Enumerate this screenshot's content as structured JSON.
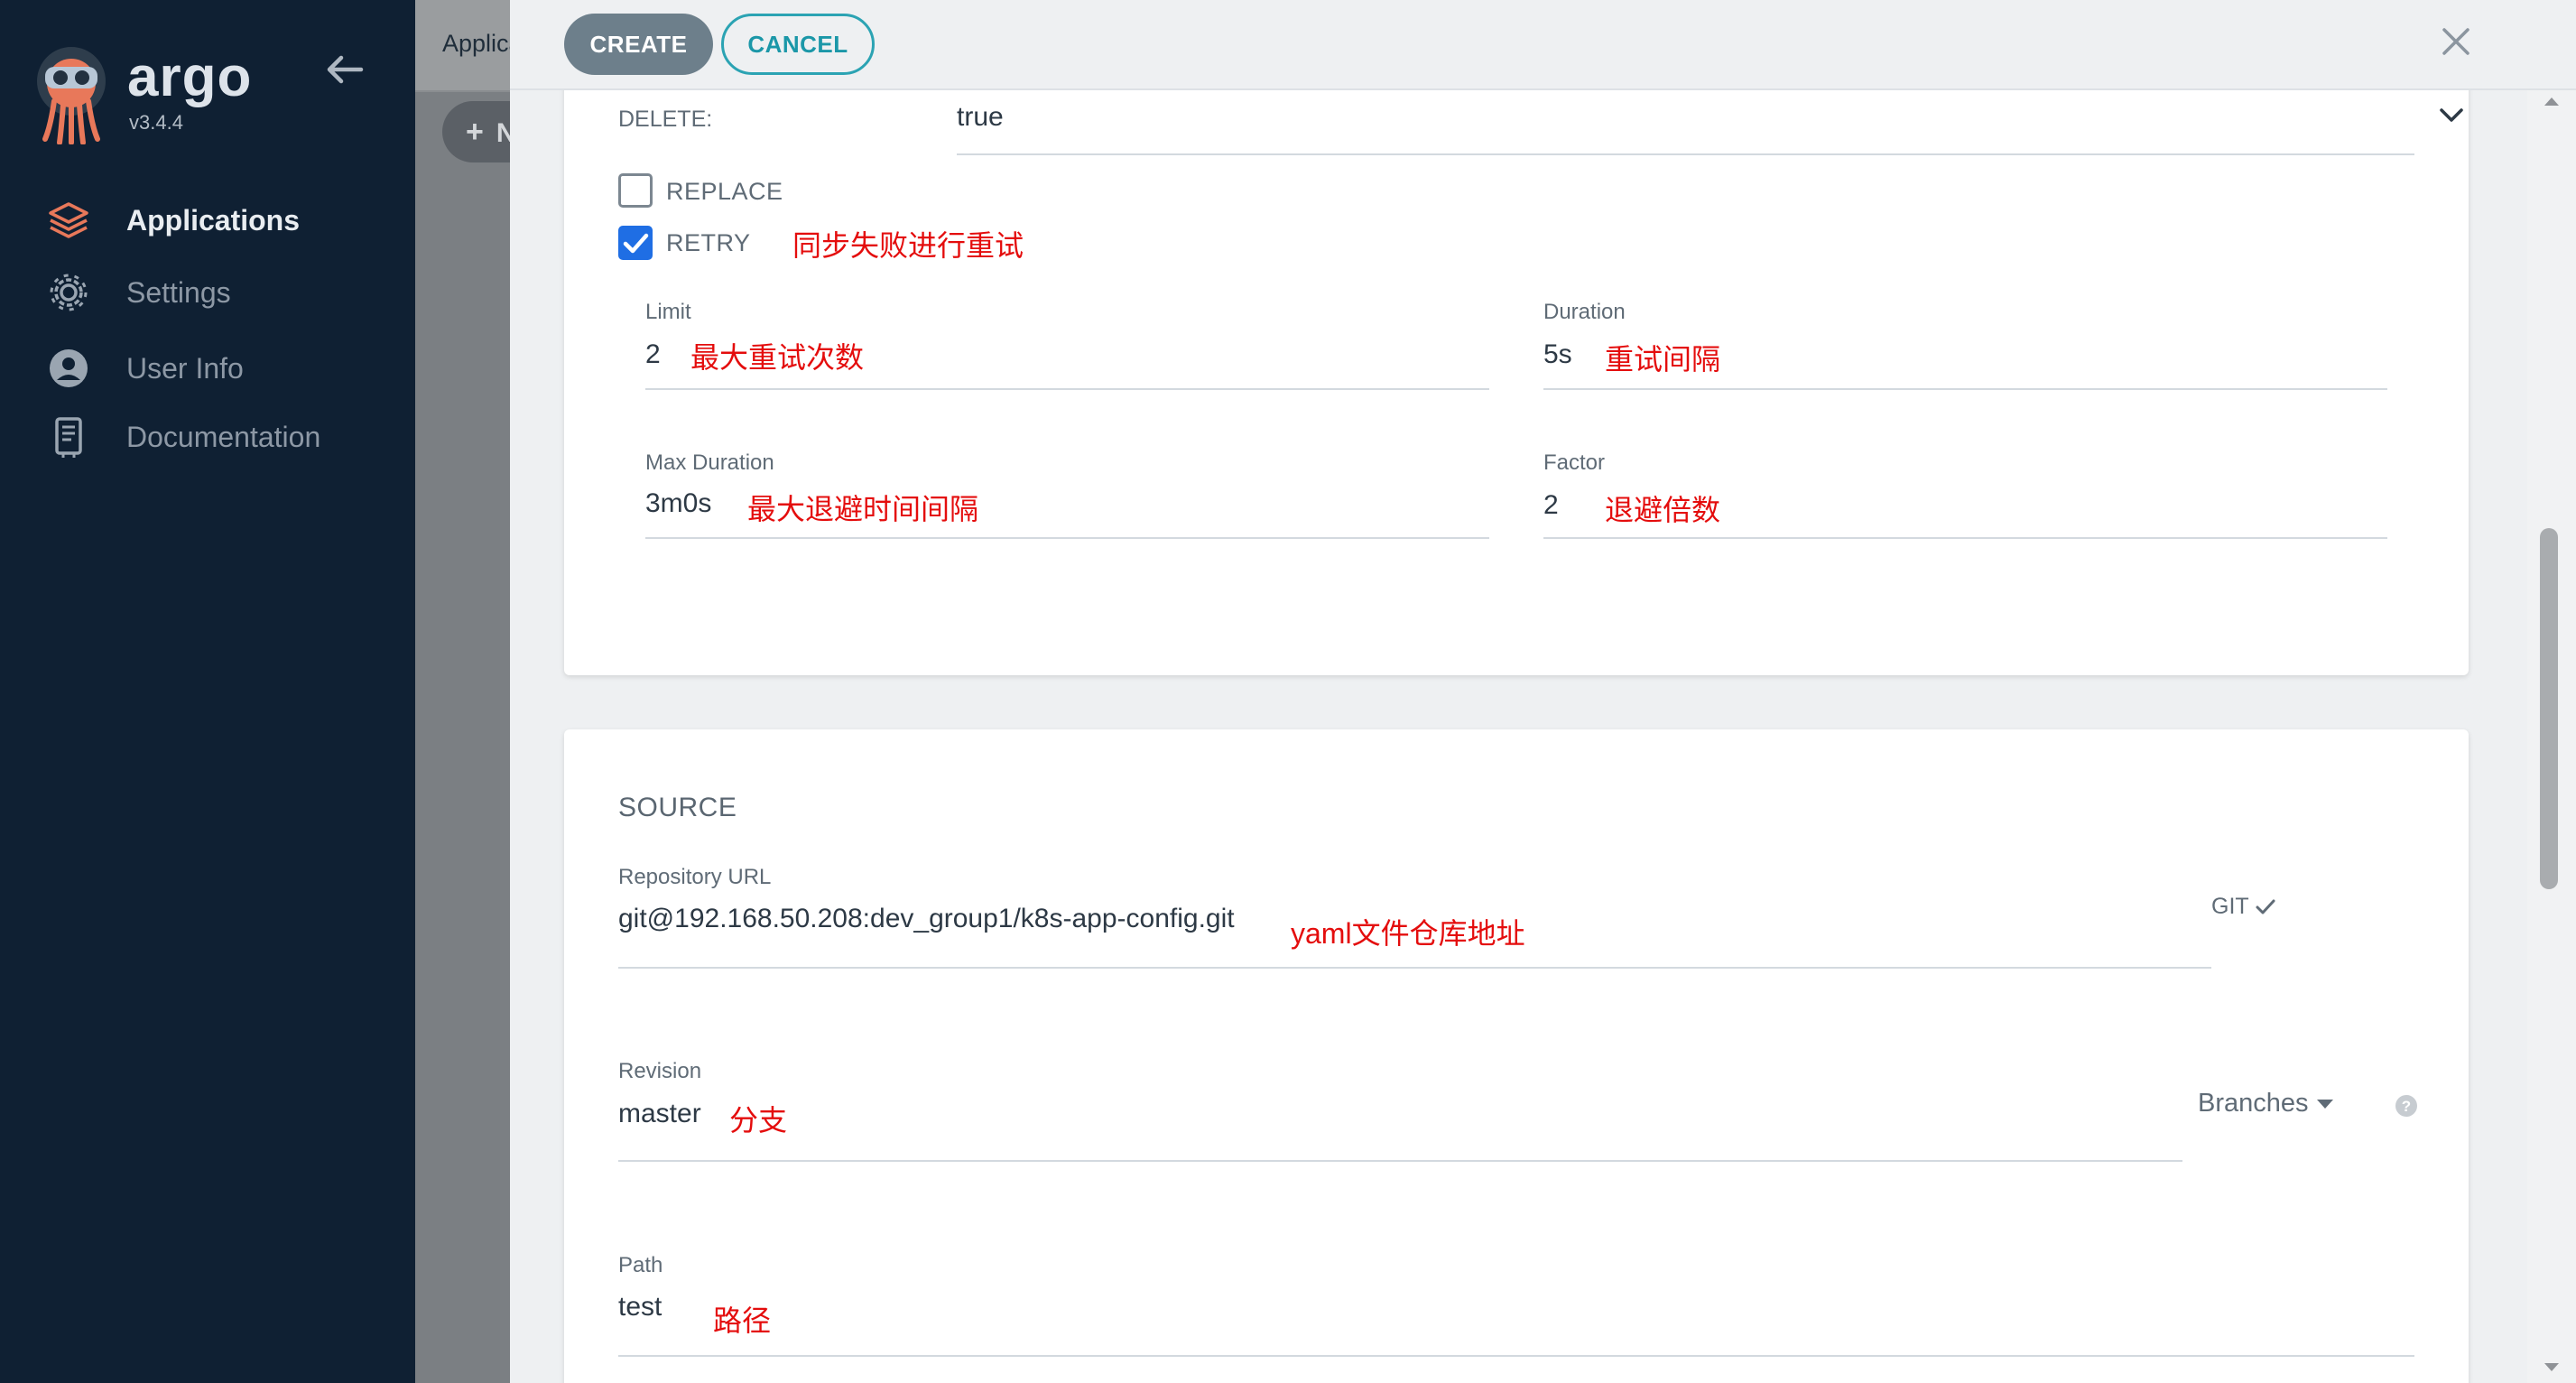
{
  "sidebar": {
    "brand": "argo",
    "version": "v3.4.4",
    "items": [
      {
        "label": "Applications",
        "icon": "layers-icon"
      },
      {
        "label": "Settings",
        "icon": "gear-icon"
      },
      {
        "label": "User Info",
        "icon": "user-circle-icon"
      },
      {
        "label": "Documentation",
        "icon": "book-icon"
      }
    ]
  },
  "background_page": {
    "title": "Applica",
    "new_app_label": "N"
  },
  "panel": {
    "create_label": "CREATE",
    "cancel_label": "CANCEL",
    "sync_options": {
      "delete_label": "DELETE:",
      "delete_value": "true",
      "replace_label": "REPLACE",
      "replace_checked": false,
      "retry_label": "RETRY",
      "retry_checked": true,
      "retry_note": "同步失败进行重试",
      "limit_label": "Limit",
      "limit_value": "2",
      "limit_note": "最大重试次数",
      "duration_label": "Duration",
      "duration_value": "5s",
      "duration_note": "重试间隔",
      "max_duration_label": "Max Duration",
      "max_duration_value": "3m0s",
      "max_duration_note": "最大退避时间间隔",
      "factor_label": "Factor",
      "factor_value": "2",
      "factor_note": "退避倍数"
    },
    "source": {
      "title": "SOURCE",
      "repo_url_label": "Repository URL",
      "repo_url_value": "git@192.168.50.208:dev_group1/k8s-app-config.git",
      "repo_url_note": "yaml文件仓库地址",
      "repo_type": "GIT",
      "revision_label": "Revision",
      "revision_value": "master",
      "revision_note": "分支",
      "revision_mode": "Branches",
      "path_label": "Path",
      "path_value": "test",
      "path_note": "路径"
    }
  },
  "colors": {
    "sidebar_bg": "#0f2033",
    "accent_teal": "#1b97a8",
    "checkbox_blue": "#1f6ee4",
    "annotation_red": "#e40d0d"
  }
}
